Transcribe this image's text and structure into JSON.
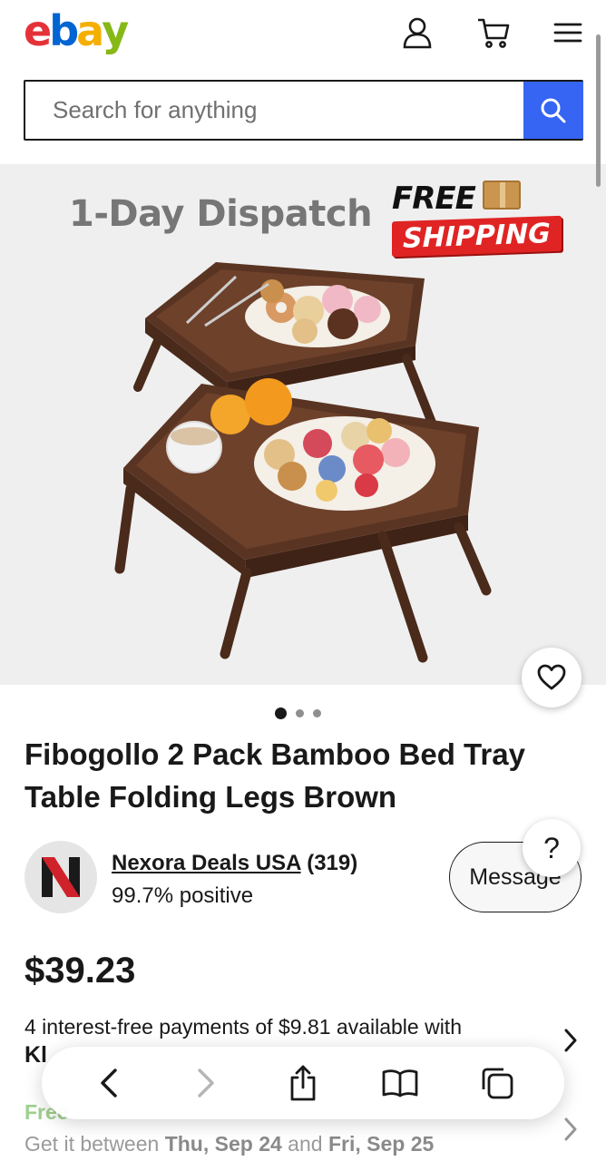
{
  "header": {
    "logo_letters": [
      "e",
      "b",
      "a",
      "y"
    ],
    "logo_colors": [
      "#e53238",
      "#0064d2",
      "#f5af02",
      "#86b817"
    ],
    "icons": [
      "user-icon",
      "cart-icon",
      "menu-icon"
    ]
  },
  "search": {
    "placeholder": "Search for anything",
    "button_color": "#3665f3"
  },
  "hero": {
    "dispatch_text": "1-Day Dispatch",
    "free_text": "FREE",
    "shipping_text": "SHIPPING",
    "image_count": 3,
    "active_image_index": 0
  },
  "product": {
    "title": "Fibogollo 2 Pack Bamboo Bed Tray Table Folding Legs Brown",
    "price": "$39.23"
  },
  "seller": {
    "name": "Nexora Deals USA",
    "feedback_count": "(319)",
    "positive": "99.7% positive",
    "message_label": "Message",
    "help_label": "?"
  },
  "payments": {
    "text": "4 interest-free payments of $9.81 available with",
    "provider_partial": "Kl"
  },
  "delivery": {
    "free_partial": "Free",
    "get_it_prefix": "Get it between ",
    "date_start": "Thu, Sep 24",
    "and": " and ",
    "date_end": "Fri, Sep 25"
  },
  "toolbar": {
    "icons": [
      "back-arrow-icon",
      "forward-arrow-icon",
      "share-icon",
      "bookmarks-icon",
      "tabs-icon"
    ]
  }
}
